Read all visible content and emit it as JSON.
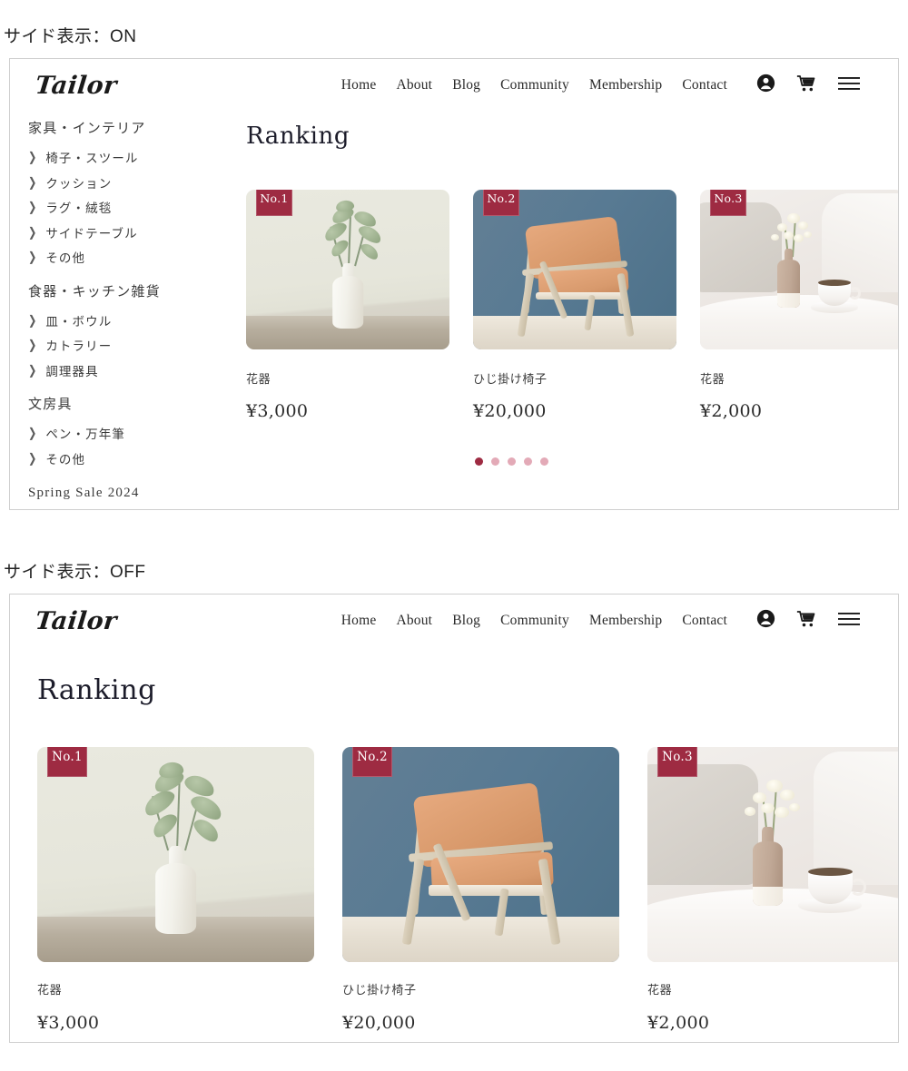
{
  "labels": {
    "sidebar_on": "サイド表示：ON",
    "sidebar_off": "サイド表示：OFF"
  },
  "header": {
    "logo": "Tailor",
    "nav": [
      {
        "label": "Home"
      },
      {
        "label": "About"
      },
      {
        "label": "Blog"
      },
      {
        "label": "Community"
      },
      {
        "label": "Membership"
      },
      {
        "label": "Contact"
      }
    ],
    "icons": [
      {
        "name": "account-icon"
      },
      {
        "name": "cart-icon"
      },
      {
        "name": "hamburger-menu-icon"
      }
    ]
  },
  "sidebar": {
    "groups": [
      {
        "title": "家具・インテリア",
        "items": [
          "椅子・スツール",
          "クッション",
          "ラグ・絨毯",
          "サイドテーブル",
          "その他"
        ]
      },
      {
        "title": "食器・キッチン雑貨",
        "items": [
          "皿・ボウル",
          "カトラリー",
          "調理器具"
        ]
      },
      {
        "title": "文房具",
        "items": [
          "ペン・万年筆",
          "その他"
        ]
      },
      {
        "title": "Spring Sale 2024",
        "items": []
      }
    ],
    "chevron": "❯"
  },
  "main": {
    "heading": "Ranking",
    "products": [
      {
        "rank": "No.1",
        "name": "花器",
        "price": "¥3,000"
      },
      {
        "rank": "No.2",
        "name": "ひじ掛け椅子",
        "price": "¥20,000"
      },
      {
        "rank": "No.3",
        "name": "花器",
        "price": "¥2,000"
      }
    ],
    "pagination": {
      "count": 5,
      "active_index": 0
    }
  },
  "colors": {
    "badge": "#9e2b42",
    "dot_active": "#9e2b42",
    "dot_inactive": "#e3aab7",
    "panel_border": "#cfcfcf",
    "text": "#2b2b2b"
  }
}
